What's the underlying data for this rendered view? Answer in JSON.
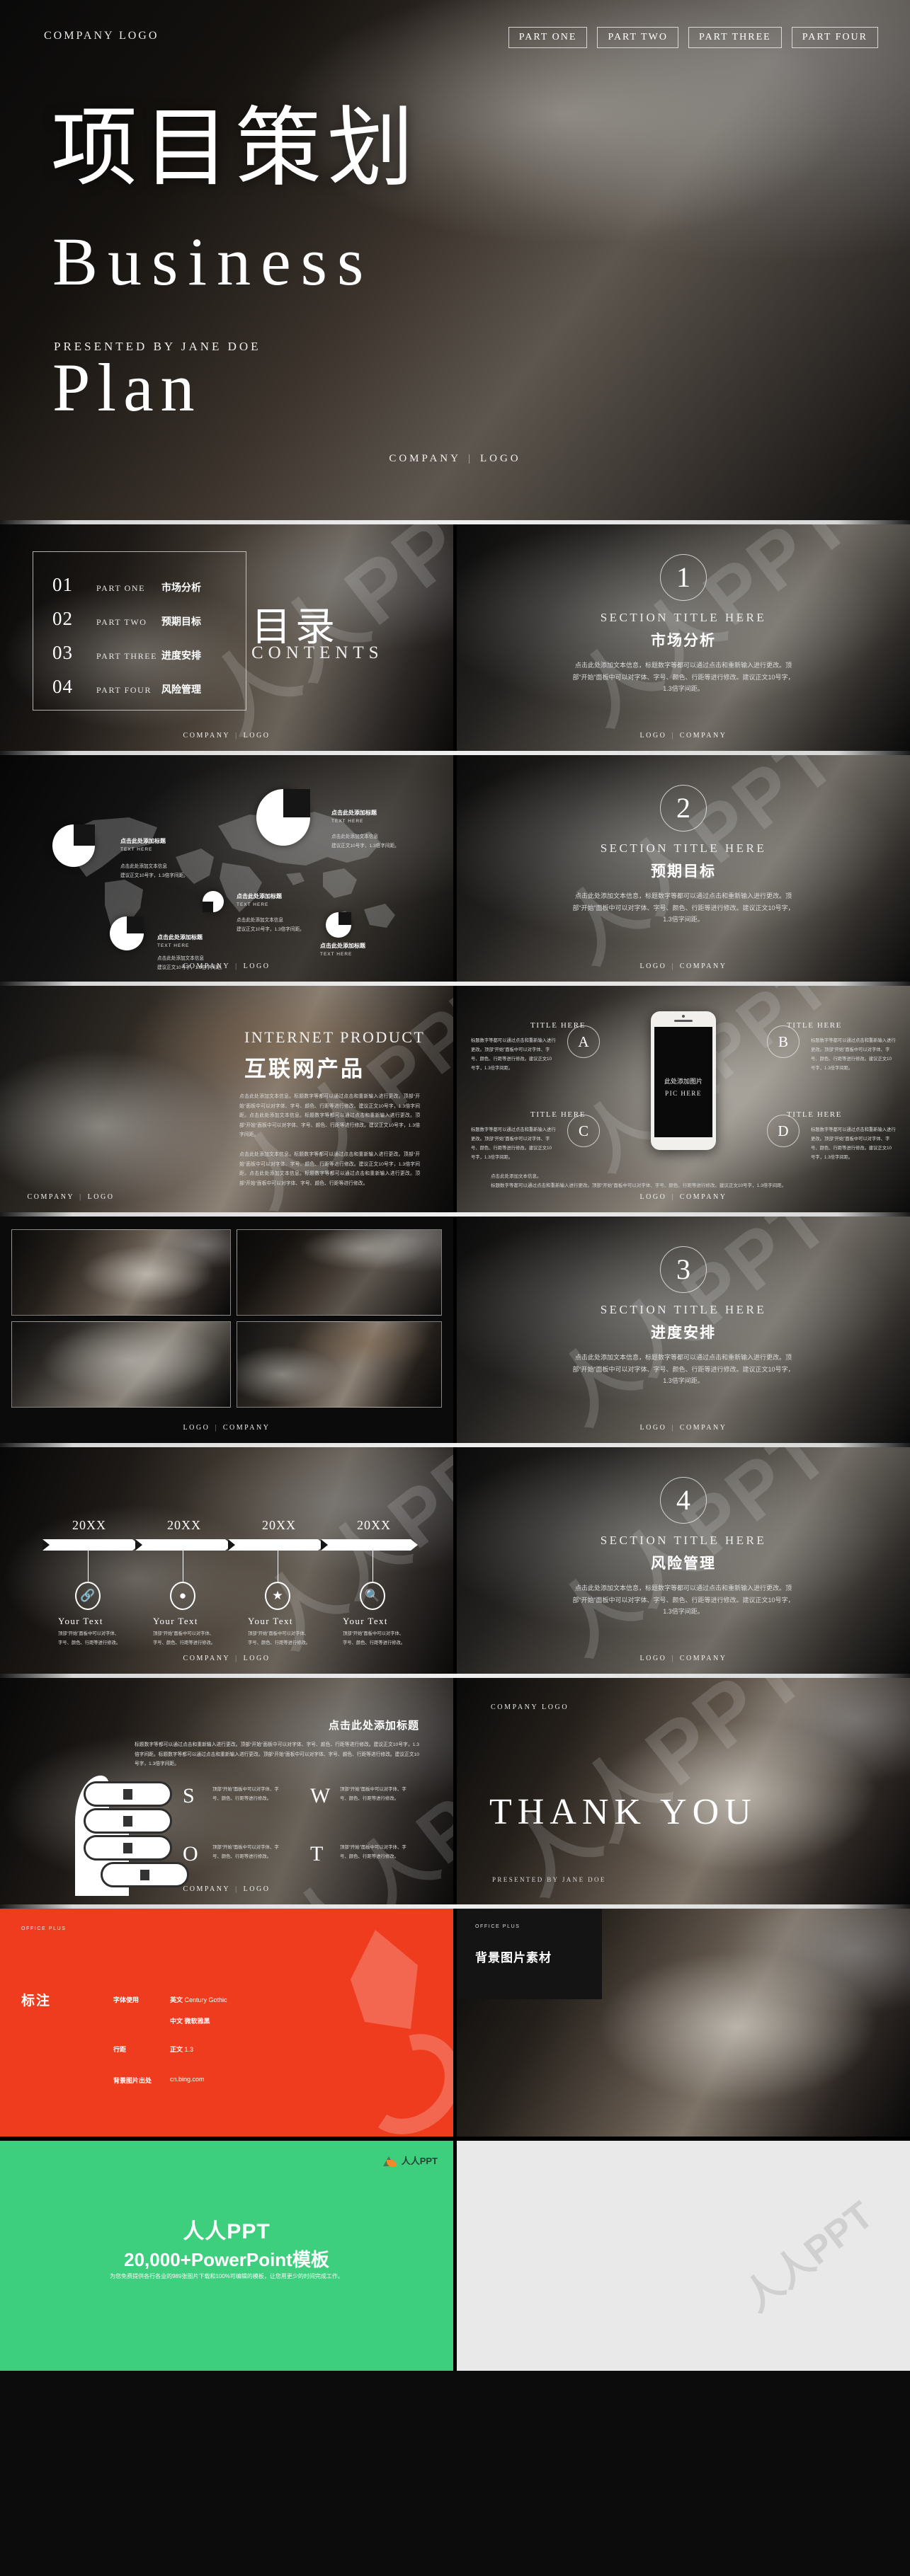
{
  "hero": {
    "company_logo": "COMPANY LOGO",
    "nav": [
      "PART ONE",
      "PART TWO",
      "PART THREE",
      "PART FOUR"
    ],
    "title_cn": "项目策划",
    "title_en_line1": "Business",
    "title_en_line2": "Plan",
    "presented_by": "PRESENTED BY JANE DOE",
    "footer_left": "COMPANY",
    "footer_right": "LOGO"
  },
  "toc": {
    "big_cn": "目录",
    "big_en": "CONTENTS",
    "items": [
      {
        "num": "01",
        "en": "PART ONE",
        "cn": "市场分析"
      },
      {
        "num": "02",
        "en": "PART TWO",
        "cn": "预期目标"
      },
      {
        "num": "03",
        "en": "PART THREE",
        "cn": "进度安排"
      },
      {
        "num": "04",
        "en": "PART FOUR",
        "cn": "风险管理"
      }
    ],
    "footer_left": "COMPANY",
    "footer_right": "LOGO"
  },
  "sections": [
    {
      "num": "1",
      "en": "SECTION TITLE HERE",
      "cn": "市场分析",
      "desc": "点击此处添加文本信息，标题数字等都可以通过点击和重新输入进行更改。顶部“开始”面板中可以对字体、字号、颜色、行距等进行修改。建议正文10号字，1.3倍字间距。",
      "footer_left": "LOGO",
      "footer_right": "COMPANY"
    },
    {
      "num": "2",
      "en": "SECTION TITLE HERE",
      "cn": "预期目标",
      "desc": "点击此处添加文本信息，标题数字等都可以通过点击和重新输入进行更改。顶部“开始”面板中可以对字体、字号、颜色、行距等进行修改。建议正文10号字，1.3倍字间距。",
      "footer_left": "LOGO",
      "footer_right": "COMPANY"
    },
    {
      "num": "3",
      "en": "SECTION TITLE HERE",
      "cn": "进度安排",
      "desc": "点击此处添加文本信息，标题数字等都可以通过点击和重新输入进行更改。顶部“开始”面板中可以对字体、字号、颜色、行距等进行修改。建议正文10号字，1.3倍字间距。",
      "footer_left": "LOGO",
      "footer_right": "COMPANY"
    },
    {
      "num": "4",
      "en": "SECTION TITLE HERE",
      "cn": "风险管理",
      "desc": "点击此处添加文本信息，标题数字等都可以通过点击和重新输入进行更改。顶部“开始”面板中可以对字体、字号、颜色、行距等进行修改。建议正文10号字，1.3倍字间距。",
      "footer_left": "LOGO",
      "footer_right": "COMPANY"
    }
  ],
  "map_slide": {
    "markers": [
      {
        "title": "点击此处添加标题",
        "sub": "TEXT HERE",
        "body": "点击此处添加文本信息<br>建议正文10号字，1.3倍字间距。"
      },
      {
        "title": "点击此处添加标题",
        "sub": "TEXT HERE",
        "body": "点击此处添加文本信息<br>建议正文10号字，1.3倍字间距。"
      },
      {
        "title": "点击此处添加标题",
        "sub": "TEXT HERE",
        "body": "点击此处添加文本信息<br>建议正文10号字，1.3倍字间距。"
      },
      {
        "title": "点击此处添加标题",
        "sub": "TEXT HERE",
        "body": "点击此处添加文本信息<br>建议正文10号字，1.3倍字间距。"
      },
      {
        "title": "点击此处添加标题",
        "sub": "TEXT HERE",
        "body": "点击此处添加文本信息<br>建议正文10号字，1.3倍字间距。"
      }
    ],
    "footer_left": "COMPANY",
    "footer_right": "LOGO"
  },
  "internet": {
    "title_en": "INTERNET PRODUCT",
    "title_cn": "互联网产品",
    "para1": "点击此处添加文本信息。标题数字等都可以通过点击和重新输入进行更改。顶部“开始”面板中可以对字体、字号、颜色、行距等进行修改。建议正文10号字，1.3倍字间距。点击此处添加文本信息。标题数字等都可以通过点击和重新输入进行更改。顶部“开始”面板中可以对字体、字号、颜色、行距等进行修改。建议正文10号字，1.3倍字间距。",
    "para2": "点击此处添加文本信息。标题数字等都可以通过点击和重新输入进行更改。顶部“开始”面板中可以对字体、字号、颜色、行距等进行修改。建议正文10号字，1.3倍字间距。点击此处添加文本信息。标题数字等都可以通过点击和重新输入进行更改。顶部“开始”面板中可以对字体、字号、颜色、行距等进行修改。",
    "footer_left": "COMPANY",
    "footer_right": "LOGO"
  },
  "phone_slide": {
    "pic_cn": "此处添加图片",
    "pic_en": "PIC HERE",
    "items": [
      {
        "letter": "A",
        "title": "TITLE HERE",
        "body": "标题数字等都可以通过点击和重新输入进行更改。顶部“开始”面板中可以对字体、字号、颜色、行距等进行修改。建议正文10号字，1.3倍字间距。"
      },
      {
        "letter": "B",
        "title": "TITLE HERE",
        "body": "标题数字等都可以通过点击和重新输入进行更改。顶部“开始”面板中可以对字体、字号、颜色、行距等进行修改。建议正文10号字，1.3倍字间距。"
      },
      {
        "letter": "C",
        "title": "TITLE HERE",
        "body": "标题数字等都可以通过点击和重新输入进行更改。顶部“开始”面板中可以对字体、字号、颜色、行距等进行修改。建议正文10号字，1.3倍字间距。"
      },
      {
        "letter": "D",
        "title": "TITLE HERE",
        "body": "标题数字等都可以通过点击和重新输入进行更改。顶部“开始”面板中可以对字体、字号、颜色、行距等进行修改。建议正文10号字，1.3倍字间距。"
      }
    ],
    "bottom_line1": "点击此处添加文本信息。",
    "bottom_line2": "标题数字等都可以通过点击和重新输入进行更改。顶部“开始”面板中可以对字体、字号、颜色、行距等进行修改。建议正文10号字，1.3倍字间距。",
    "footer_left": "LOGO",
    "footer_right": "COMPANY"
  },
  "gallery": {
    "footer_left": "LOGO",
    "footer_right": "COMPANY"
  },
  "timeline": {
    "years": [
      "20XX",
      "20XX",
      "20XX",
      "20XX"
    ],
    "items": [
      {
        "icon": "link-icon",
        "glyph": "🔗",
        "title": "Your Text",
        "body": "顶部“开始”面板中可以对字体、字号、颜色、行距等进行修改。"
      },
      {
        "icon": "pin-icon",
        "glyph": "📍",
        "title": "Your Text",
        "body": "顶部“开始”面板中可以对字体、字号、颜色、行距等进行修改。"
      },
      {
        "icon": "star-icon",
        "glyph": "★",
        "title": "Your Text",
        "body": "顶部“开始”面板中可以对字体、字号、颜色、行距等进行修改。"
      },
      {
        "icon": "search-icon",
        "glyph": "🔍",
        "title": "Your Text",
        "body": "顶部“开始”面板中可以对字体、字号、颜色、行距等进行修改。"
      }
    ],
    "footer_left": "COMPANY",
    "footer_right": "LOGO"
  },
  "swot": {
    "title": "点击此处添加标题",
    "lead": "标题数字等都可以通过点击和重新输入进行更改。顶部“开始”面板中可以对字体、字号、颜色、行距等进行修改。建议正文10号字，1.3倍字间距。标题数字等都可以通过点击和重新输入进行更改。顶部“开始”面板中可以对字体、字号、颜色、行距等进行修改。建议正文10号字，1.3倍字间距。",
    "cells": [
      {
        "letter": "S",
        "body": "顶部“开始”面板中可以对字体、字号、颜色、行距等进行修改。"
      },
      {
        "letter": "W",
        "body": "顶部“开始”面板中可以对字体、字号、颜色、行距等进行修改。"
      },
      {
        "letter": "O",
        "body": "顶部“开始”面板中可以对字体、字号、颜色、行距等进行修改。"
      },
      {
        "letter": "T",
        "body": "顶部“开始”面板中可以对字体、字号、颜色、行距等进行修改。"
      }
    ],
    "footer_left": "COMPANY",
    "footer_right": "LOGO"
  },
  "thank_you": {
    "company_logo": "COMPANY LOGO",
    "title": "THANK YOU",
    "presented_by": "PRESENTED BY JANE DOE"
  },
  "notes": {
    "office_plus": "OFFICE PLUS",
    "heading": "标注",
    "rows": [
      {
        "key": "字体使用",
        "value_label": "英文",
        "value": "Century Gothic"
      },
      {
        "key": "",
        "value_label": "中文",
        "value": "微软雅黑"
      },
      {
        "key": "行距",
        "value_label": "正文",
        "value": "1.3"
      },
      {
        "key": "背景图片出处",
        "value_label": "",
        "value": "cn.bing.com"
      }
    ]
  },
  "bg_material": {
    "office_plus": "OFFICE PLUS",
    "heading": "背景图片素材"
  },
  "promo": {
    "brand": "人人PPT",
    "heading": "人人PPT",
    "subheading": "20,000+PowerPoint模板",
    "tagline": "为您免费提供各行各业的989张图片下载和100%可编辑的模板，让您用更少的时间完成工作。",
    "watermark": "人人PPT",
    "brand_color": "#3ecf7e"
  },
  "watermark_text": "人人PPT"
}
